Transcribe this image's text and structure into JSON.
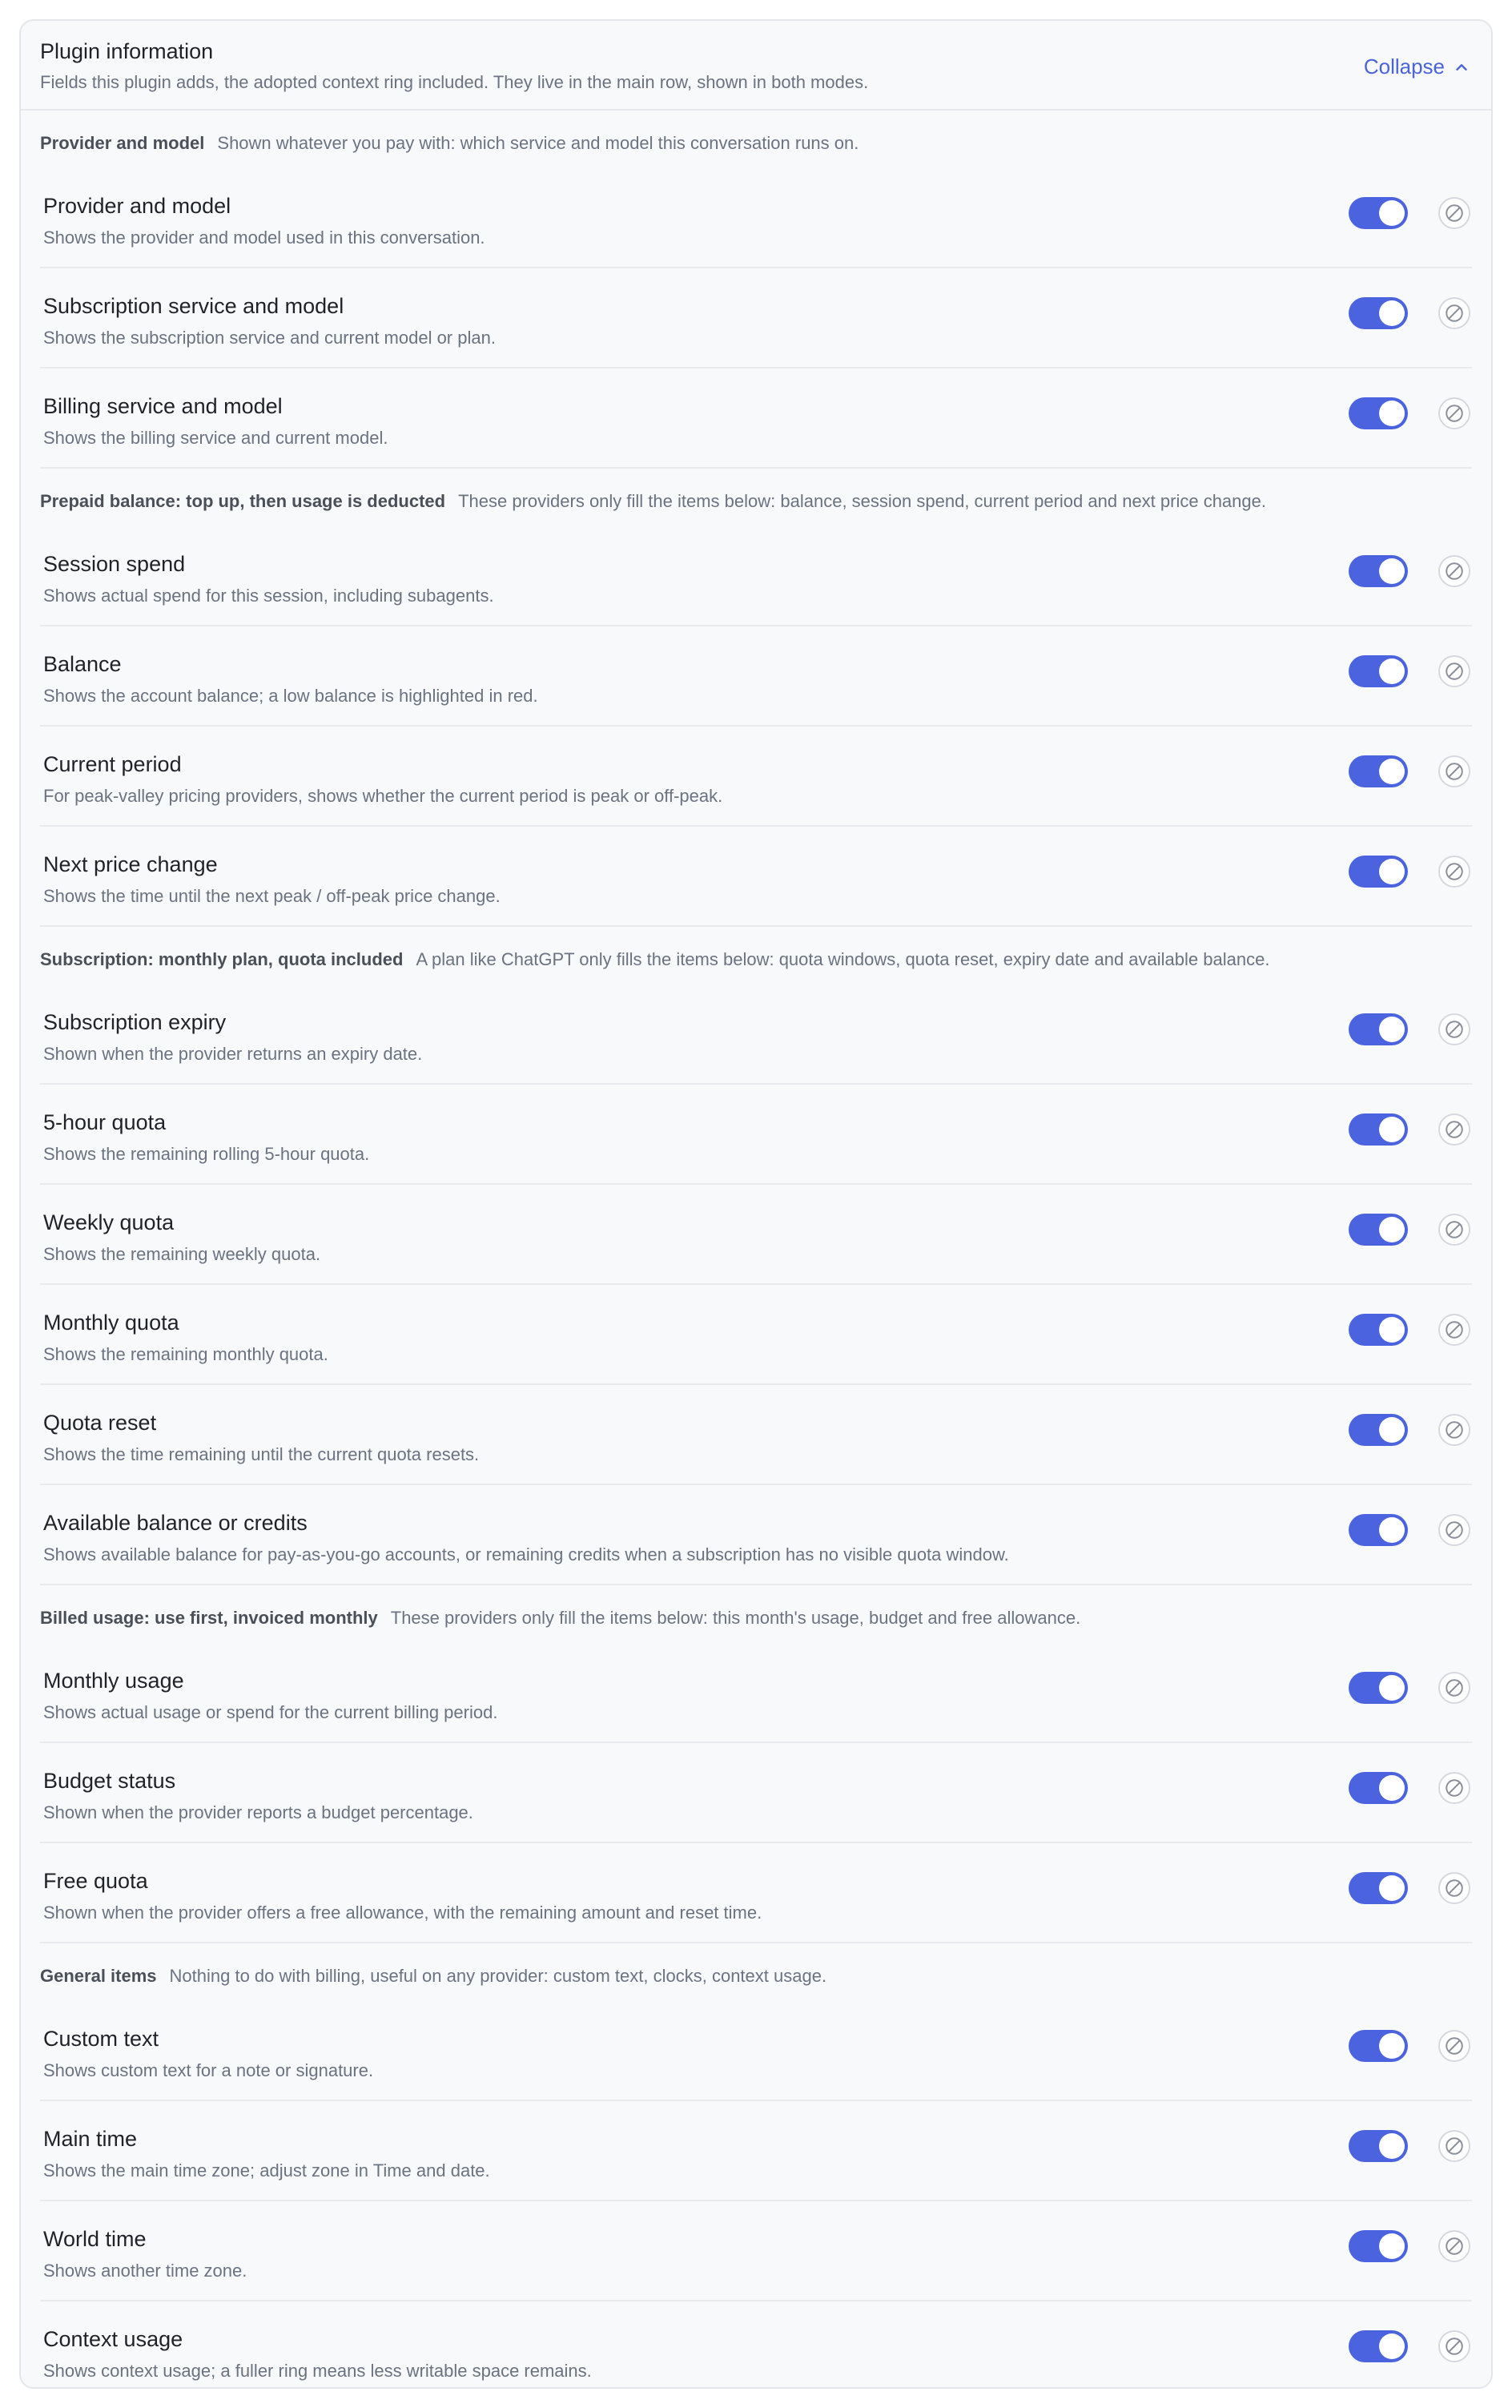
{
  "panel": {
    "title": "Plugin information",
    "subtitle": "Fields this plugin adds, the adopted context ring included. They live in the main row, shown in both modes.",
    "collapse_label": "Collapse"
  },
  "colors": {
    "accent": "#4c63e0",
    "link": "#4a63d9"
  },
  "groups": [
    {
      "title": "Provider and model",
      "desc": "Shown whatever you pay with: which service and model this conversation runs on.",
      "items": [
        {
          "title": "Provider and model",
          "desc": "Shows the provider and model used in this conversation.",
          "enabled": true
        },
        {
          "title": "Subscription service and model",
          "desc": "Shows the subscription service and current model or plan.",
          "enabled": true
        },
        {
          "title": "Billing service and model",
          "desc": "Shows the billing service and current model.",
          "enabled": true
        }
      ]
    },
    {
      "title": "Prepaid balance: top up, then usage is deducted",
      "desc": "These providers only fill the items below: balance, session spend, current period and next price change.",
      "items": [
        {
          "title": "Session spend",
          "desc": "Shows actual spend for this session, including subagents.",
          "enabled": true
        },
        {
          "title": "Balance",
          "desc": "Shows the account balance; a low balance is highlighted in red.",
          "enabled": true
        },
        {
          "title": "Current period",
          "desc": "For peak-valley pricing providers, shows whether the current period is peak or off-peak.",
          "enabled": true
        },
        {
          "title": "Next price change",
          "desc": "Shows the time until the next peak / off-peak price change.",
          "enabled": true
        }
      ]
    },
    {
      "title": "Subscription: monthly plan, quota included",
      "desc": "A plan like ChatGPT only fills the items below: quota windows, quota reset, expiry date and available balance.",
      "items": [
        {
          "title": "Subscription expiry",
          "desc": "Shown when the provider returns an expiry date.",
          "enabled": true
        },
        {
          "title": "5-hour quota",
          "desc": "Shows the remaining rolling 5-hour quota.",
          "enabled": true
        },
        {
          "title": "Weekly quota",
          "desc": "Shows the remaining weekly quota.",
          "enabled": true
        },
        {
          "title": "Monthly quota",
          "desc": "Shows the remaining monthly quota.",
          "enabled": true
        },
        {
          "title": "Quota reset",
          "desc": "Shows the time remaining until the current quota resets.",
          "enabled": true
        },
        {
          "title": "Available balance or credits",
          "desc": "Shows available balance for pay-as-you-go accounts, or remaining credits when a subscription has no visible quota window.",
          "enabled": true
        }
      ]
    },
    {
      "title": "Billed usage: use first, invoiced monthly",
      "desc": "These providers only fill the items below: this month's usage, budget and free allowance.",
      "items": [
        {
          "title": "Monthly usage",
          "desc": "Shows actual usage or spend for the current billing period.",
          "enabled": true
        },
        {
          "title": "Budget status",
          "desc": "Shown when the provider reports a budget percentage.",
          "enabled": true
        },
        {
          "title": "Free quota",
          "desc": "Shown when the provider offers a free allowance, with the remaining amount and reset time.",
          "enabled": true
        }
      ]
    },
    {
      "title": "General items",
      "desc": "Nothing to do with billing, useful on any provider: custom text, clocks, context usage.",
      "items": [
        {
          "title": "Custom text",
          "desc": "Shows custom text for a note or signature.",
          "enabled": true
        },
        {
          "title": "Main time",
          "desc": "Shows the main time zone; adjust zone in Time and date.",
          "enabled": true
        },
        {
          "title": "World time",
          "desc": "Shows another time zone.",
          "enabled": true
        },
        {
          "title": "Context usage",
          "desc": "Shows context usage; a fuller ring means less writable space remains.",
          "enabled": true
        }
      ]
    }
  ]
}
